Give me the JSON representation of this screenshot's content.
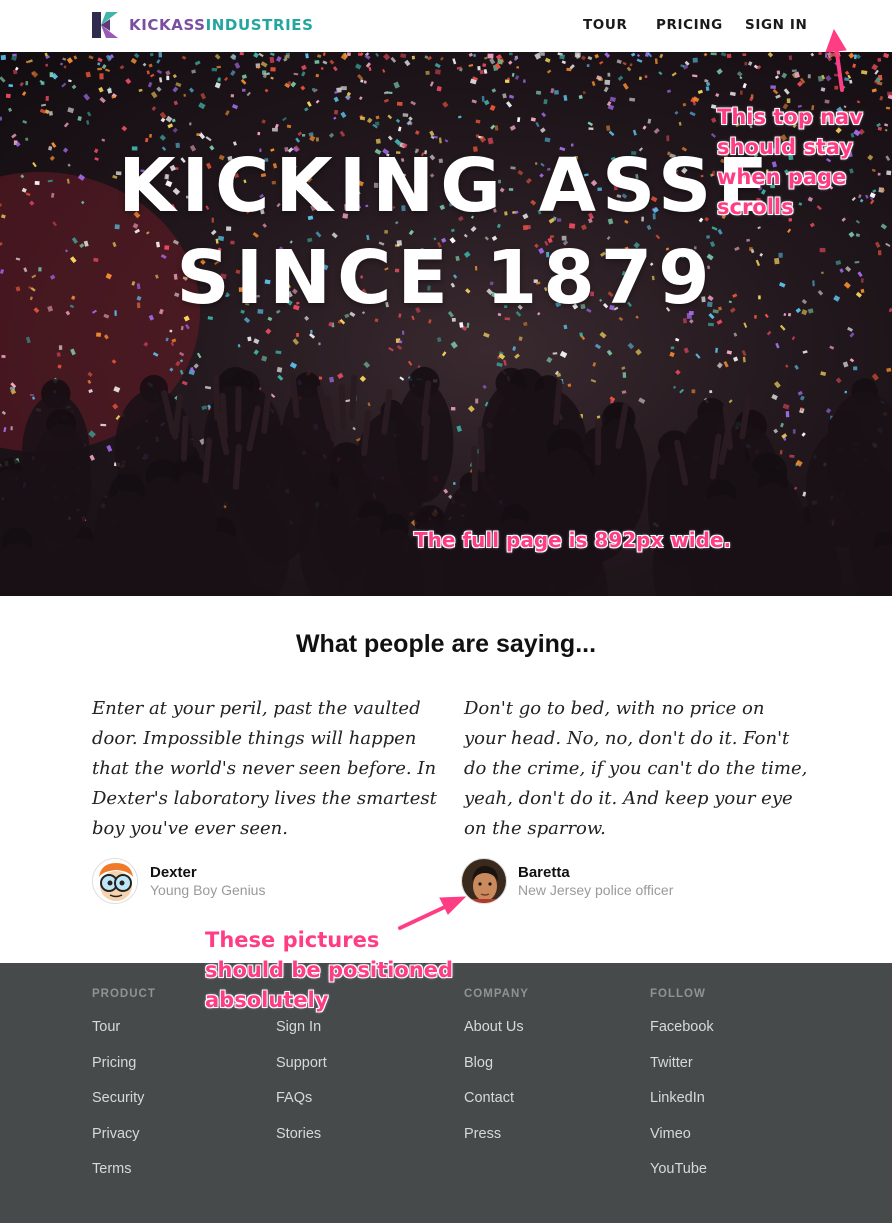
{
  "nav": {
    "logo_part1": "KICKASS",
    "logo_part2": "INDUSTRIES",
    "links": [
      "TOUR",
      "PRICING",
      "SIGN IN"
    ]
  },
  "hero": {
    "line1": "KICKING ASSE",
    "line2": "SINCE 1879"
  },
  "annotations": {
    "nav_note": "This top nav should stay when page scrolls",
    "width_note": "The full page is 892px wide.",
    "pictures_note": "These pictures should be positioned absolutely"
  },
  "testimonials": {
    "heading": "What people are saying...",
    "items": [
      {
        "quote": "Enter at your peril, past the vaulted door. Impossible things will happen that the world's never seen before. In Dexter's laboratory lives the smartest boy you've ever seen.",
        "name": "Dexter",
        "role": "Young Boy Genius"
      },
      {
        "quote": "Don't go to bed, with no price on your head. No, no, don't do it. Fon't do the crime, if you can't do the time, yeah, don't do it. And keep your eye on the sparrow.",
        "name": "Baretta",
        "role": "New Jersey police officer"
      }
    ]
  },
  "footer": {
    "columns": [
      {
        "heading": "PRODUCT",
        "links": [
          "Tour",
          "Pricing",
          "Security",
          "Privacy",
          "Terms"
        ]
      },
      {
        "heading": "",
        "links": [
          "Sign In",
          "Support",
          "FAQs",
          "Stories"
        ]
      },
      {
        "heading": "COMPANY",
        "links": [
          "About Us",
          "Blog",
          "Contact",
          "Press"
        ]
      },
      {
        "heading": "FOLLOW",
        "links": [
          "Facebook",
          "Twitter",
          "LinkedIn",
          "Vimeo",
          "YouTube"
        ]
      }
    ]
  },
  "colors": {
    "logo_purple": "#7b4e9f",
    "logo_teal": "#23a5a0",
    "annotation_pink": "#ff3d84",
    "footer_bg": "#464a4b"
  },
  "icons": {
    "logo": "kickass-k-logo-icon",
    "avatar_dexter": "dexter-avatar",
    "avatar_baretta": "baretta-avatar"
  }
}
